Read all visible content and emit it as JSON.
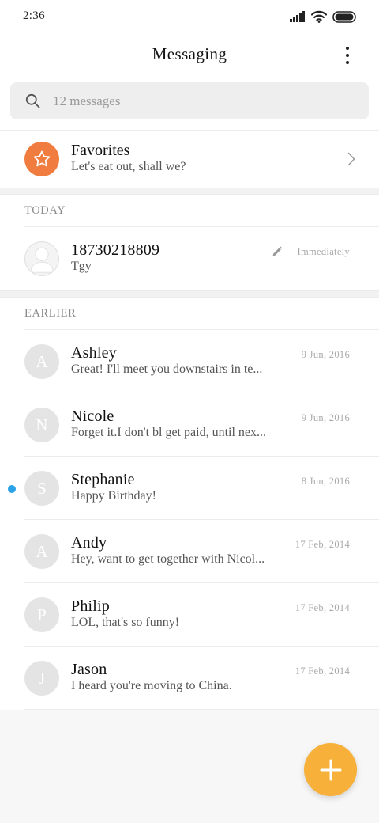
{
  "status_bar": {
    "time": "2:36",
    "icons": [
      "signal-icon",
      "wifi-icon",
      "battery-icon"
    ]
  },
  "header": {
    "title": "Messaging",
    "more_icon": "more-vertical-icon"
  },
  "search": {
    "placeholder": "12 messages",
    "value": "",
    "icon": "search-icon"
  },
  "favorites": {
    "title": "Favorites",
    "preview": "Let's eat out, shall we?",
    "icon": "star-icon",
    "icon_color": "#f07d3f"
  },
  "sections": {
    "today": "TODAY",
    "earlier": "EARLIER"
  },
  "today_messages": [
    {
      "name": "18730218809",
      "preview": "Tgy",
      "date": "Immediately",
      "draft_icon": "pencil-icon",
      "avatar_icon": "person-icon"
    }
  ],
  "earlier_messages": [
    {
      "initial": "A",
      "name": "Ashley",
      "preview": "Great! I'll meet you downstairs in te...",
      "date": "9 Jun, 2016",
      "unread": false
    },
    {
      "initial": "N",
      "name": "Nicole",
      "preview": "Forget it.I don't bl get paid, until nex...",
      "date": "9 Jun, 2016",
      "unread": false
    },
    {
      "initial": "S",
      "name": "Stephanie",
      "preview": "Happy Birthday!",
      "date": "8 Jun, 2016",
      "unread": true
    },
    {
      "initial": "A",
      "name": "Andy",
      "preview": "Hey, want to get together with Nicol...",
      "date": "17 Feb, 2014",
      "unread": false
    },
    {
      "initial": "P",
      "name": "Philip",
      "preview": "LOL, that's so funny!",
      "date": "17 Feb, 2014",
      "unread": false
    },
    {
      "initial": "J",
      "name": "Jason",
      "preview": "I heard you're moving to China.",
      "date": "17 Feb, 2014",
      "unread": false
    }
  ],
  "fab": {
    "icon": "plus-icon",
    "color": "#f7b13a"
  },
  "colors": {
    "unread_dot": "#2aa2e8",
    "avatar_bg": "#e4e4e4"
  }
}
